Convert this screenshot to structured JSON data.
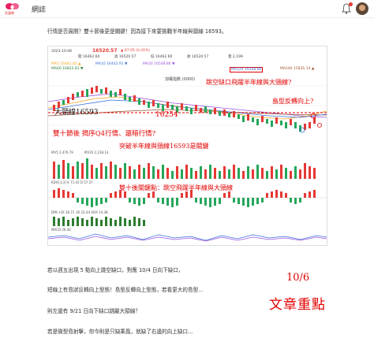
{
  "app": {
    "logo_text": "花藝網",
    "section_title": "網誌"
  },
  "article": {
    "para_1": "行情是否展開？雙十節後更是關鍵！因為接下來要挑戰半年線與頸線 16593。",
    "para_2": "若以週五出現 5 點向上跳空缺口，對應 10/4 日向下缺口，",
    "para_3": "短線上有島狀反轉向上型態！島型反轉向上型態，若看更大的島型...",
    "para_4": "則左邊有 9/21 日向下缺口跳離大頸線？",
    "para_5": "若是微型島射擊，你今則是只缺乘風，就缺了右邊的向上缺口..."
  },
  "chart": {
    "date": "2023-10-06",
    "price": "16520.57",
    "change": "▲ 67.05 (0.41%)",
    "vol_label": "量 2,199",
    "ohlc": [
      "開 16462.60",
      "高 16520.57",
      "低 16462.60",
      "收 16520.57"
    ],
    "ma_legend": [
      "MA5 16481.82 ▲",
      "MA10 16442.91 ▼",
      "MA20 16548.86 ▼",
      "MA60 16822.81 ▼",
      "MA120 16548.86",
      "MA240 15835.14 ▲"
    ],
    "index_name": "加權指數 (0000)",
    "sub_labels": [
      "MV5 2,476.79",
      "MV20 2,238.14",
      "KD(9,3,3) K 71.42 D 57.37",
      "DMI +DI 18.71 -DI 22.44 ADX 14.38",
      "MACD 26.40"
    ],
    "colors": {
      "up": "#e53935",
      "down": "#26a65b",
      "ma_orange": "#f5a623",
      "ma_blue": "#3a6fd8",
      "ma_purple": "#9b51e0",
      "ann_red": "#e30000"
    }
  },
  "annotations": {
    "gap_jump": "跳空缺口飛躍半年線與大頸線?",
    "neck_line": "大頸線16593",
    "low_16254": "16254",
    "island": "島型反轉向上?",
    "q4_trend": "雙十節後 揭序Q4行情、還暗行情?",
    "break_neck": "突破半年線與頸線16593是關鍵",
    "key_point": "雙十後關鍵點：跳空飛躍半年線與大頸線",
    "date_mark": "10/6",
    "note": "文章重點"
  }
}
